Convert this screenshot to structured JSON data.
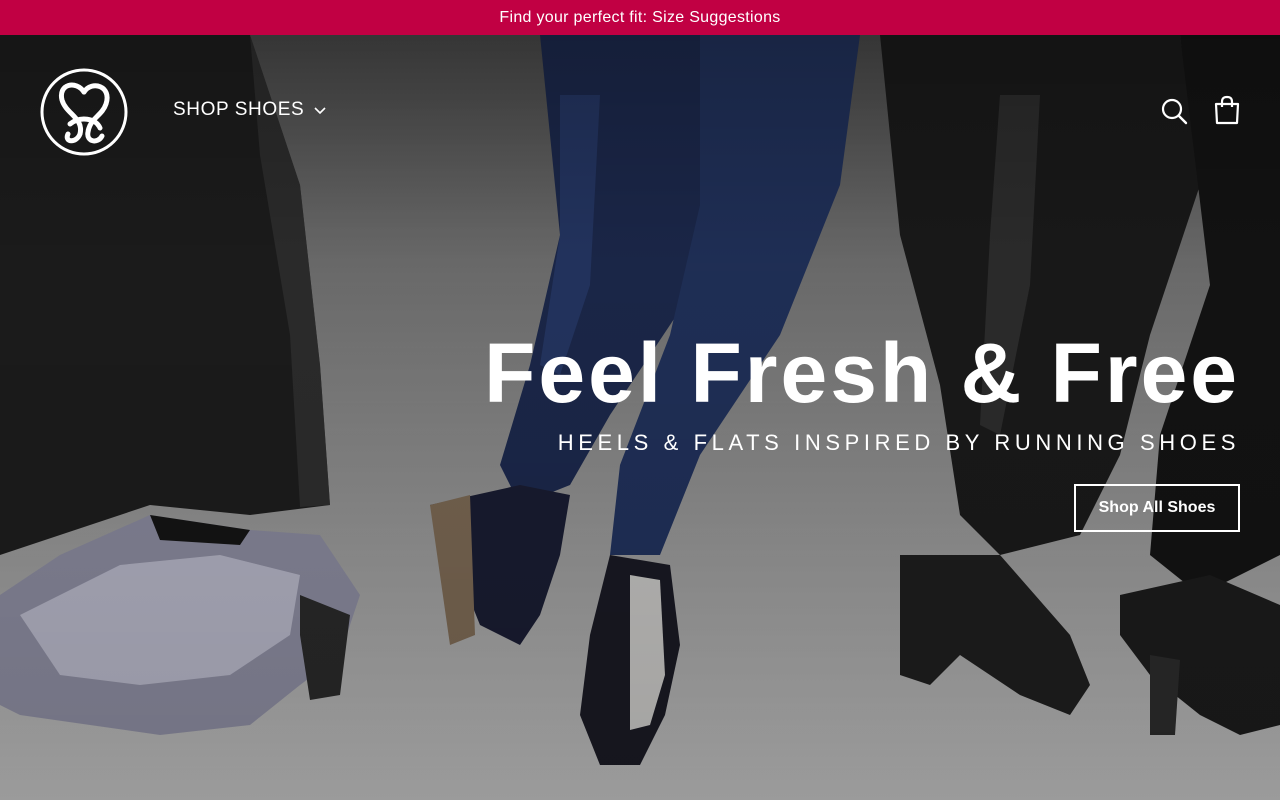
{
  "announcement": {
    "text": "Find your perfect fit: Size Suggestions"
  },
  "header": {
    "logo_icon": "brand-heart-logo-icon",
    "nav": {
      "shop_label": "SHOP SHOES",
      "shop_icon": "chevron-down-icon"
    },
    "search_icon": "search-icon",
    "cart_icon": "shopping-bag-icon"
  },
  "hero": {
    "title": "Feel Fresh & Free",
    "subtitle": "HEELS & FLATS INSPIRED BY RUNNING SHOES",
    "cta_label": "Shop All Shoes",
    "image": "three-women-wearing-heels"
  },
  "colors": {
    "announcement_bg": "#c10043",
    "text_on_hero": "#ffffff"
  }
}
